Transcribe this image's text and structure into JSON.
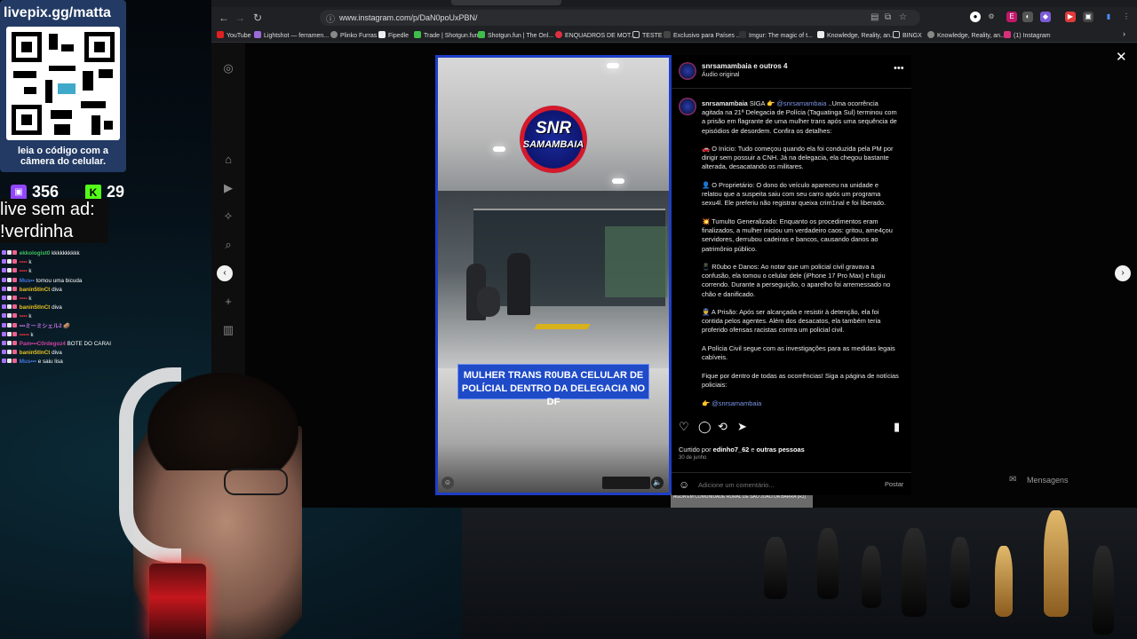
{
  "browser": {
    "url": "www.instagram.com/p/DaN0poUxPBN/",
    "bookmarks": [
      "YouTube",
      "Lightshot — ferramen...",
      "Plinko Furras",
      "Fipedle",
      "Trade | Shotgun.fun",
      "Shotgun.fun | The Onl...",
      "ENQUADROS DE MOT...",
      "TESTE",
      "Exclusivo para Países ...",
      "Imgur: The magic of t...",
      "Knowledge, Reality, an...",
      "BINGX",
      "Knowledge, Reality, an...",
      "(1) Instagram"
    ]
  },
  "post": {
    "handle": "snrsamambaia e outros 4",
    "audio": "Áudio original",
    "logo_line1": "SNR",
    "logo_line2": "SAMAMBAIA",
    "video_caption": "MULHER TRANS R0UBA CELULAR DE POLÍCIAL DENTRO DA DELEGACIA NO DF",
    "under_text": "AGUA EM COMUNIDADE RURAL DE SÃO JOÃO DA BARRA (RJ)",
    "desc_author": "snrsamambaia",
    "desc_siga": "SIGA 👉",
    "desc_mention": "@snrsamambaia",
    "desc_p1": "..Uma ocorrência agitada na 21ª Delegacia de Polícia (Taguatinga Sul) terminou com a prisão em flagrante de uma mulher trans após uma sequência de episódios de desordem. Confira os detalhes:",
    "desc_p2": "🚗 O Início: Tudo começou quando ela foi conduzida pela PM por dirigir sem possuir a CNH. Já na delegacia, ela chegou bastante alterada, desacatando os militares.",
    "desc_p3": "👤 O Proprietário: O dono do veículo apareceu na unidade e relatou que a suspeita saiu com seu carro após um programa sexu4l. Ele preferiu não registrar queixa crim1nal e foi liberado.",
    "desc_p4": "💥 Tumulto Generalizado: Enquanto os procedimentos eram finalizados, a mulher iniciou um verdadeiro caos: gritou, ame4çou servidores, derrubou cadeiras e bancos, causando danos ao patrimônio público.",
    "desc_p5": "📱 R0ubo e Danos: Ao notar que um policial civil gravava a confusão, ela tomou o celular dele (iPhone 17 Pro Max) e fugiu correndo. Durante a perseguição, o aparelho foi arremessado no chão e danificado.",
    "desc_p6": "👮 A Prisão: Após ser alcançada e resistir à detenção, ela foi contida pelos agentes. Além dos desacatos, ela também teria proferido ofensas racistas contra um policial civil.",
    "desc_p7": "A Polícia Civil segue com as investigações para as medidas legais cabíveis.",
    "desc_p8": "Fique por dentro de todas as ocorrências! Siga a página de notícias policiais:",
    "desc_p9_icon": "👉",
    "desc_p9_link": "@snrsamambaia",
    "liked_prefix": "Curtido por",
    "liked_user": "edinho7_62",
    "liked_and": "e",
    "liked_others": "outras pessoas",
    "date": "30 de junho",
    "comment_placeholder": "Adicione um comentário...",
    "post_button": "Postar",
    "messages_label": "Mensagens"
  },
  "overlay": {
    "qr_title": "livepix.gg/matta",
    "qr_text": "leia o código com a câmera do celular.",
    "twitch_count": "356",
    "kick_count": "29",
    "ad_line1": "live sem ad:",
    "ad_line2": "!verdinha",
    "chat": [
      {
        "user": "ekkologist0",
        "msg": "kkkkkkkkkk",
        "color": "#3fc060"
      },
      {
        "user": "••••",
        "msg": "k",
        "color": "#e0303a"
      },
      {
        "user": "••••",
        "msg": "k",
        "color": "#e0303a"
      },
      {
        "user": "Mus••",
        "msg": "tomou uma bicuda",
        "color": "#4a76e0"
      },
      {
        "user": "banin5tlnCt",
        "msg": "diva",
        "color": "#e8c020"
      },
      {
        "user": "••••",
        "msg": "k",
        "color": "#e0303a"
      },
      {
        "user": "banin5tlnCt",
        "msg": "diva",
        "color": "#e8c020"
      },
      {
        "user": "••••",
        "msg": "k",
        "color": "#e0303a"
      },
      {
        "user": "•••ミーミシェル2",
        "msg": "🥔",
        "color": "#c070e0"
      },
      {
        "user": "•••••",
        "msg": "k",
        "color": "#e0303a"
      },
      {
        "user": "Pam•••C0rdegoz4",
        "msg": "BOTE DO CARAI",
        "color": "#d040a0"
      },
      {
        "user": "banin5tlnCt",
        "msg": "diva",
        "color": "#e8c020"
      },
      {
        "user": "Mus•••",
        "msg": "e saiu lisa",
        "color": "#4a76e0"
      }
    ]
  }
}
